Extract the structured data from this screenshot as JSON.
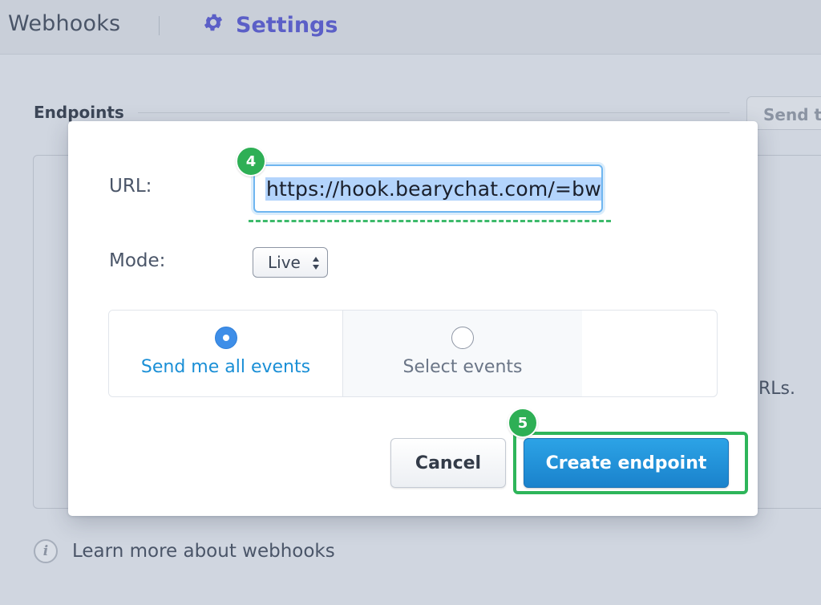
{
  "header": {
    "breadcrumb": "Webhooks",
    "active_tab": "Settings",
    "active_color": "#5b5fc7"
  },
  "page": {
    "section_title": "Endpoints",
    "send_test_label": "Send te",
    "truncated_fragment": "RLs.",
    "learn_more": "Learn more about webhooks",
    "info_icon_glyph": "i"
  },
  "modal": {
    "url_label": "URL:",
    "url_value": "https://hook.bearychat.com/=bw",
    "mode_label": "Mode:",
    "mode_value": "Live",
    "event_options": [
      {
        "label": "Send me all events",
        "selected": true
      },
      {
        "label": "Select events",
        "selected": false
      }
    ],
    "cancel_label": "Cancel",
    "create_label": "Create endpoint"
  },
  "annotations": {
    "step_url": "4",
    "step_create": "5",
    "highlight_color": "#2eb55a"
  }
}
